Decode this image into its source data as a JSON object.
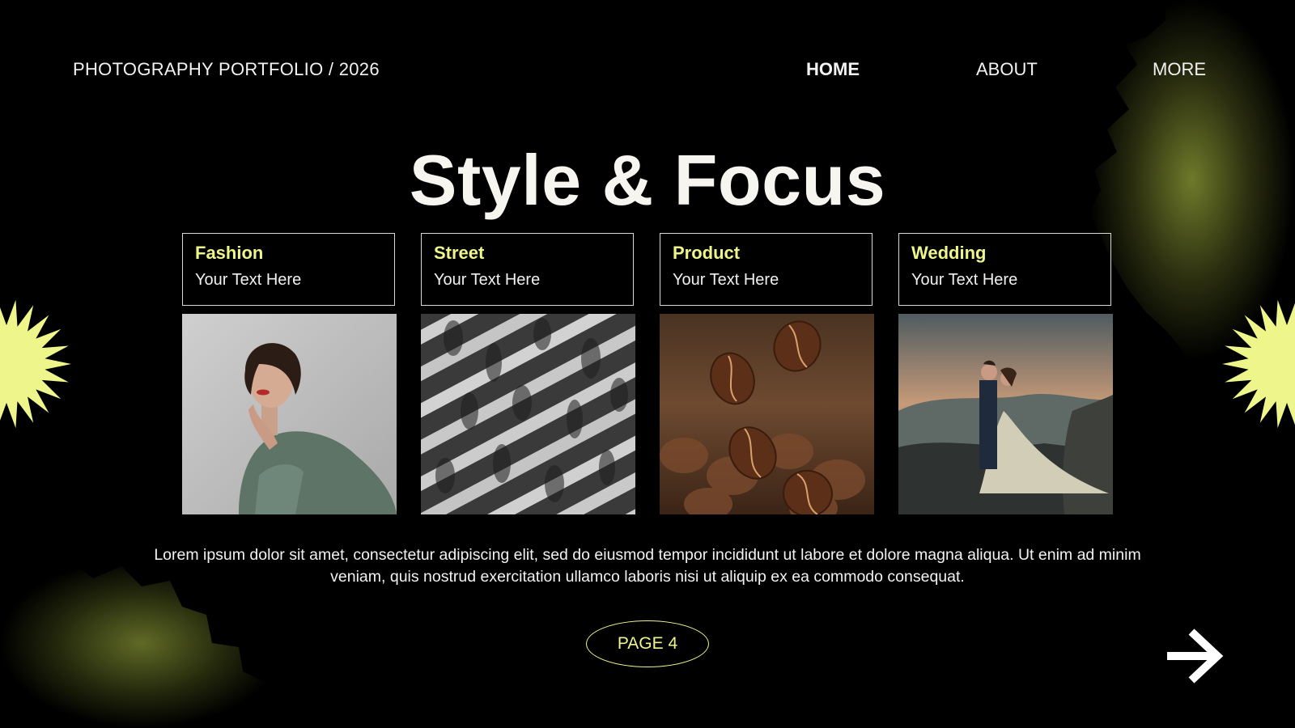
{
  "header": {
    "brand": "PHOTOGRAPHY PORTFOLIO / 2026",
    "nav": [
      {
        "label": "HOME",
        "active": true
      },
      {
        "label": "ABOUT",
        "active": false
      },
      {
        "label": "MORE",
        "active": false
      }
    ]
  },
  "main": {
    "title": "Style & Focus",
    "categories": [
      {
        "title": "Fashion",
        "text": "Your Text Here",
        "image": "fashion-portrait-woman"
      },
      {
        "title": "Street",
        "text": "Your Text Here",
        "image": "street-crosswalk-crowd"
      },
      {
        "title": "Product",
        "text": "Your Text Here",
        "image": "coffee-beans"
      },
      {
        "title": "Wedding",
        "text": "Your Text Here",
        "image": "wedding-couple-mountains"
      }
    ],
    "body_text": "Lorem ipsum dolor sit amet, consectetur adipiscing elit, sed do eiusmod tempor incididunt ut labore et dolore magna aliqua. Ut enim ad minim veniam, quis nostrud exercitation ullamco laboris nisi ut aliquip ex ea commodo consequat."
  },
  "footer": {
    "page_label": "PAGE 4",
    "next_icon": "arrow-right-icon"
  },
  "colors": {
    "background": "#000000",
    "accent": "#eef58a",
    "text": "#f2f2f2"
  }
}
